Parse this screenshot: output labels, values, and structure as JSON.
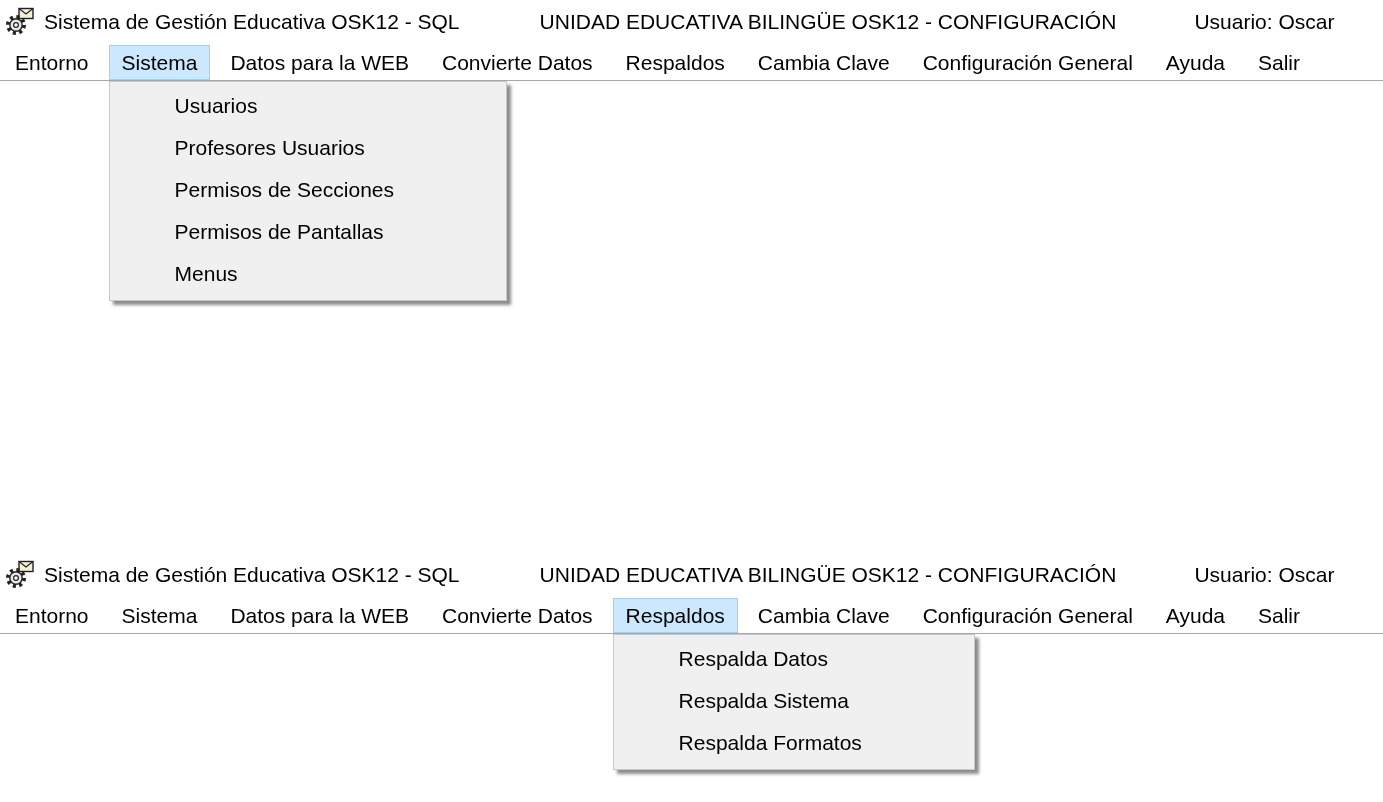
{
  "windows": [
    {
      "title": "Sistema de Gestión Educativa OSK12 - SQL",
      "institution": "UNIDAD EDUCATIVA BILINGÜE OSK12 - CONFIGURACIÓN",
      "user": "Usuario: Oscar",
      "menu_bar": [
        {
          "label": "Entorno",
          "selected": false
        },
        {
          "label": "Sistema",
          "selected": true,
          "submenu": [
            "Usuarios",
            "Profesores Usuarios",
            "Permisos de Secciones",
            "Permisos de Pantallas",
            "Menus"
          ]
        },
        {
          "label": "Datos para la WEB",
          "selected": false
        },
        {
          "label": "Convierte Datos",
          "selected": false
        },
        {
          "label": "Respaldos",
          "selected": false
        },
        {
          "label": "Cambia Clave",
          "selected": false
        },
        {
          "label": "Configuración General",
          "selected": false
        },
        {
          "label": "Ayuda",
          "selected": false
        },
        {
          "label": "Salir",
          "selected": false
        }
      ]
    },
    {
      "title": "Sistema de Gestión Educativa OSK12 - SQL",
      "institution": "UNIDAD EDUCATIVA BILINGÜE OSK12 - CONFIGURACIÓN",
      "user": "Usuario: Oscar",
      "menu_bar": [
        {
          "label": "Entorno",
          "selected": false
        },
        {
          "label": "Sistema",
          "selected": false
        },
        {
          "label": "Datos para la WEB",
          "selected": false
        },
        {
          "label": "Convierte Datos",
          "selected": false
        },
        {
          "label": "Respaldos",
          "selected": true,
          "submenu": [
            "Respalda Datos",
            "Respalda Sistema",
            "Respalda Formatos"
          ]
        },
        {
          "label": "Cambia Clave",
          "selected": false
        },
        {
          "label": "Configuración General",
          "selected": false
        },
        {
          "label": "Ayuda",
          "selected": false
        },
        {
          "label": "Salir",
          "selected": false
        }
      ]
    }
  ]
}
